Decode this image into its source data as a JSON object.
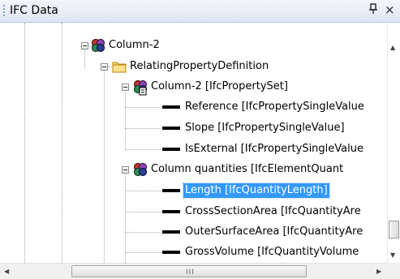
{
  "window": {
    "title": "IFC Data",
    "pin_glyph": "ᵖ",
    "close_glyph": "×",
    "pin_icon": "pin-icon",
    "close_icon": "close-icon"
  },
  "tree": {
    "nodes": [
      {
        "label": "Column-2",
        "icon": "ifc-object-icon"
      },
      {
        "label": "RelatingPropertyDefinition",
        "icon": "folder-icon"
      },
      {
        "label": "Column-2 [IfcPropertySet]",
        "icon": "ifc-propertyset-icon"
      },
      {
        "label": "Reference [IfcPropertySingleValue",
        "icon": "property-bar-icon"
      },
      {
        "label": "Slope [IfcPropertySingleValue]",
        "icon": "property-bar-icon"
      },
      {
        "label": "IsExternal [IfcPropertySingleValue",
        "icon": "property-bar-icon"
      },
      {
        "label": "Column quantities [IfcElementQuant",
        "icon": "ifc-object-icon"
      },
      {
        "label": "Length [IfcQuantityLength]",
        "icon": "property-bar-icon",
        "selected": true
      },
      {
        "label": "CrossSectionArea [IfcQuantityAre",
        "icon": "property-bar-icon"
      },
      {
        "label": "OuterSurfaceArea [IfcQuantityAre",
        "icon": "property-bar-icon"
      },
      {
        "label": "GrossVolume [IfcQuantityVolume",
        "icon": "property-bar-icon"
      }
    ]
  },
  "scrollbars": {
    "vertical": {
      "up_glyph": "▲",
      "down_glyph": "▼"
    },
    "horizontal": {
      "left_glyph": "◀",
      "right_glyph": "▶",
      "grip_glyph": "III"
    }
  },
  "colors": {
    "selection": "#3399ff",
    "title_gradient_top": "#f3f6fb",
    "title_gradient_bottom": "#dde6f3"
  }
}
